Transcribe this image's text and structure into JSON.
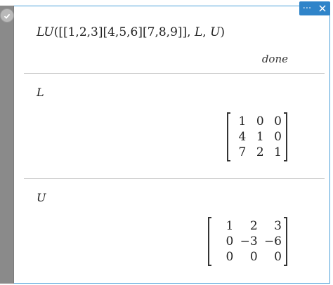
{
  "toolbar": {
    "more_label": "···"
  },
  "entry": {
    "input": {
      "func": "LU",
      "open_paren": "(",
      "matrix_arg": "[[1,2,3][4,5,6][7,8,9]]",
      "sep1": ", ",
      "arg2": "L",
      "sep2": ", ",
      "arg3": "U",
      "close_paren": ")"
    },
    "result": "done"
  },
  "L": {
    "label": "L",
    "rows": [
      [
        "1",
        "0",
        "0"
      ],
      [
        "4",
        "1",
        "0"
      ],
      [
        "7",
        "2",
        "1"
      ]
    ]
  },
  "U": {
    "label": "U",
    "rows": [
      [
        "1",
        "2",
        "3"
      ],
      [
        "0",
        "−3",
        "−6"
      ],
      [
        "0",
        "0",
        "0"
      ]
    ]
  }
}
